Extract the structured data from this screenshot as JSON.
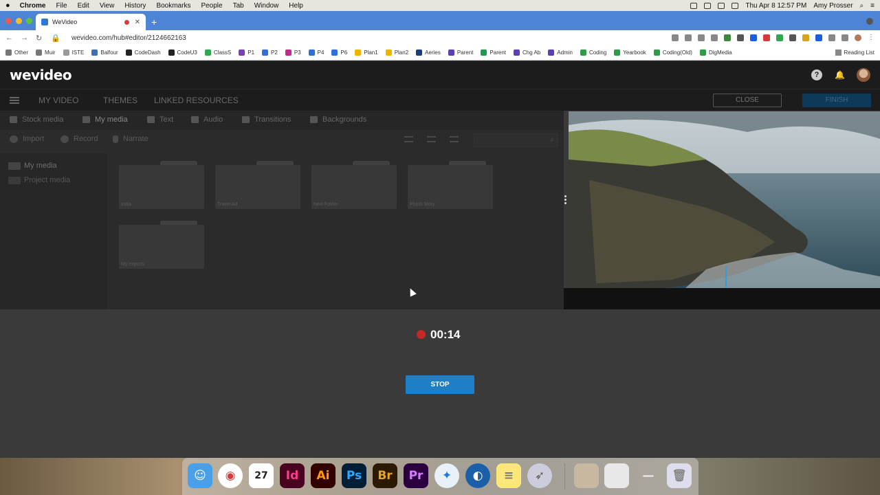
{
  "menubar": {
    "app": "Chrome",
    "items": [
      "File",
      "Edit",
      "View",
      "History",
      "Bookmarks",
      "People",
      "Tab",
      "Window",
      "Help"
    ],
    "datetime": "Thu Apr 8  12:57 PM",
    "user": "Amy Prosser"
  },
  "browser": {
    "tab_title": "WeVideo",
    "url": "wevideo.com/hub#editor/2124662163",
    "bookmarks": [
      {
        "label": "Other",
        "color": "#777777"
      },
      {
        "label": "Muir",
        "color": "#777777"
      },
      {
        "label": "ISTE",
        "color": "#999999"
      },
      {
        "label": "Balfour",
        "color": "#3d6fb5"
      },
      {
        "label": "CodeDash",
        "color": "#222222"
      },
      {
        "label": "CodeU3",
        "color": "#222222"
      },
      {
        "label": "ClassS",
        "color": "#2fa84f"
      },
      {
        "label": "P1",
        "color": "#7b3fb5"
      },
      {
        "label": "P2",
        "color": "#2f6fd8"
      },
      {
        "label": "P3",
        "color": "#c02a8a"
      },
      {
        "label": "P4",
        "color": "#2f6fd8"
      },
      {
        "label": "P6",
        "color": "#2f6fd8"
      },
      {
        "label": "Plan1",
        "color": "#f0b400"
      },
      {
        "label": "Plan2",
        "color": "#f0b400"
      },
      {
        "label": "Aeries",
        "color": "#1a3e7a"
      },
      {
        "label": "Parent",
        "color": "#5a3fb5"
      },
      {
        "label": "Parent",
        "color": "#1e9a4a"
      },
      {
        "label": "Chg Ab",
        "color": "#5a3fb5"
      },
      {
        "label": "Admin",
        "color": "#5a3fb5"
      },
      {
        "label": "Coding",
        "color": "#2f9a4a"
      },
      {
        "label": "Yearbook",
        "color": "#2f9a4a"
      },
      {
        "label": "Coding(Old)",
        "color": "#2f9a4a"
      },
      {
        "label": "DigMedia",
        "color": "#2f9a4a"
      }
    ],
    "reading_list": "Reading List"
  },
  "app": {
    "logo": "wevideo",
    "nav": [
      "MY VIDEO",
      "THEMES",
      "LINKED RESOURCES"
    ],
    "close_label": "CLOSE",
    "finish_label": "FINISH",
    "media_tabs": [
      "Stock media",
      "My media",
      "Text",
      "Audio",
      "Transitions",
      "Backgrounds"
    ],
    "tools": [
      "Import",
      "Record",
      "Narrate"
    ],
    "sidebar": [
      "My media",
      "Project media"
    ],
    "folders": [
      "India",
      "Travel Ad",
      "New Folder",
      "Photo Story",
      "My exports"
    ]
  },
  "recorder": {
    "time": "00:14",
    "stop_label": "STOP"
  },
  "colors": {
    "accent": "#1e7fc6",
    "record": "#c62828"
  }
}
